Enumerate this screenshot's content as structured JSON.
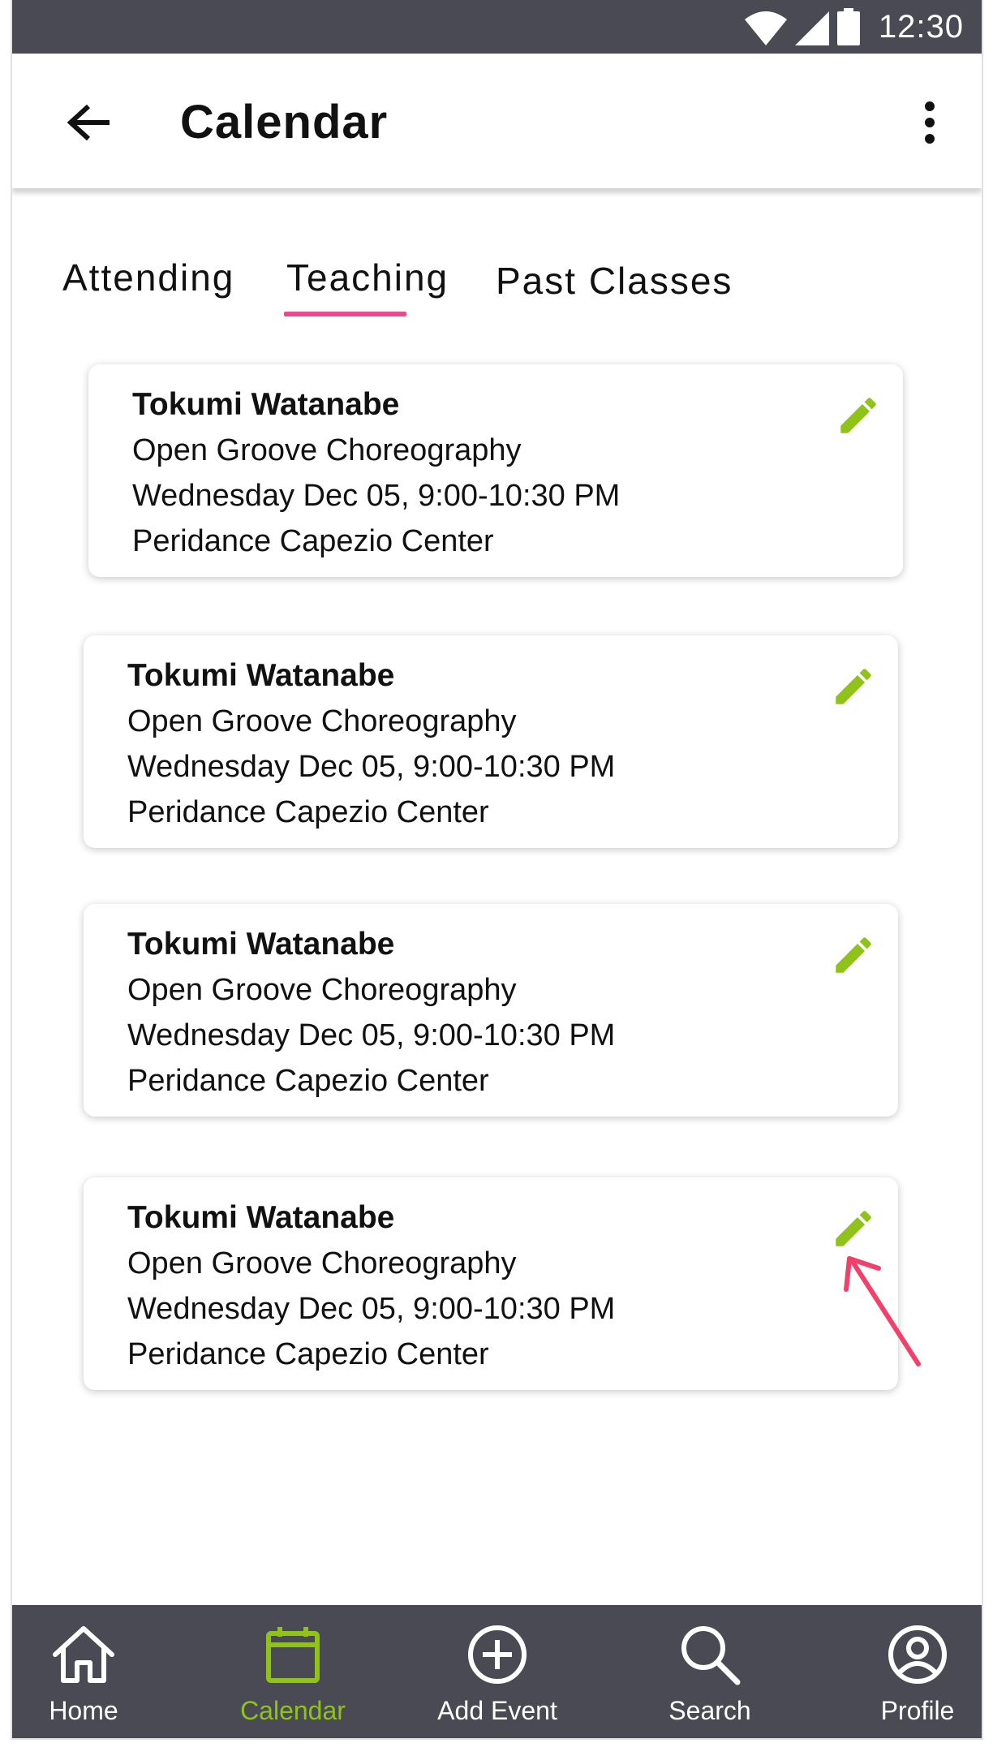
{
  "status_bar": {
    "time": "12:30"
  },
  "app_bar": {
    "title": "Calendar",
    "back_icon": "arrow-left-icon",
    "more_icon": "more-vert-icon"
  },
  "tabs": [
    {
      "label": "Attending",
      "active": false
    },
    {
      "label": "Teaching",
      "active": true
    },
    {
      "label": "Past Classes",
      "active": false
    }
  ],
  "events": [
    {
      "instructor": "Tokumi Watanabe",
      "class": "Open Groove Choreography",
      "datetime": "Wednesday Dec 05, 9:00-10:30 PM",
      "location": "Peridance Capezio Center"
    },
    {
      "instructor": "Tokumi Watanabe",
      "class": "Open Groove Choreography",
      "datetime": "Wednesday Dec 05, 9:00-10:30 PM",
      "location": "Peridance Capezio Center"
    },
    {
      "instructor": "Tokumi Watanabe",
      "class": "Open Groove Choreography",
      "datetime": "Wednesday Dec 05, 9:00-10:30 PM",
      "location": "Peridance Capezio Center"
    },
    {
      "instructor": "Tokumi Watanabe",
      "class": "Open Groove Choreography",
      "datetime": "Wednesday Dec 05, 9:00-10:30 PM",
      "location": "Peridance Capezio Center"
    }
  ],
  "bottom_nav": [
    {
      "label": "Home",
      "icon": "home-icon",
      "active": false
    },
    {
      "label": "Calendar",
      "icon": "calendar-icon",
      "active": true
    },
    {
      "label": "Add Event",
      "icon": "add-circle-icon",
      "active": false
    },
    {
      "label": "Search",
      "icon": "search-icon",
      "active": false
    },
    {
      "label": "Profile",
      "icon": "profile-icon",
      "active": false
    }
  ],
  "colors": {
    "accent_green": "#90c31a",
    "tab_indicator": "#ec4a8f",
    "annotation_arrow": "#f0416a",
    "bar_background": "#4a4a55"
  }
}
